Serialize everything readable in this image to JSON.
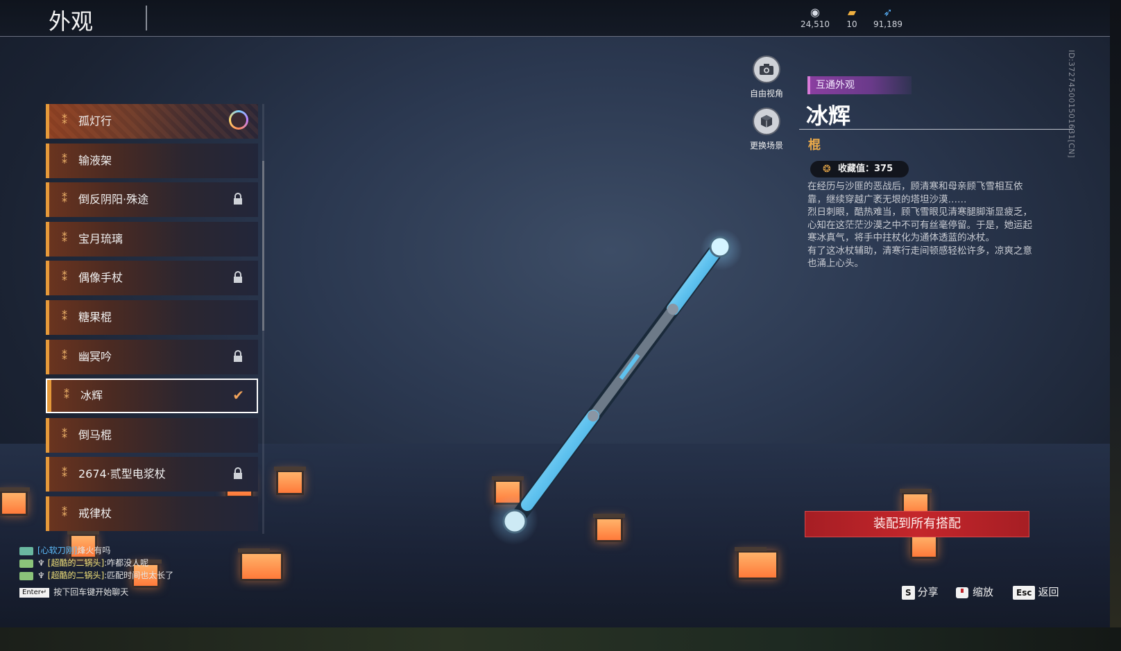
{
  "header": {
    "title": "外观",
    "currencies": [
      {
        "icon": "coin-stack-icon",
        "value": "24,510"
      },
      {
        "icon": "ticket-icon",
        "value": "10"
      },
      {
        "icon": "feather-icon",
        "value": "91,189"
      }
    ]
  },
  "list": {
    "items": [
      {
        "label": "孤灯行",
        "state": "featured"
      },
      {
        "label": "输液架",
        "state": "normal"
      },
      {
        "label": "倒反阴阳·殊途",
        "state": "locked"
      },
      {
        "label": "宝月琉璃",
        "state": "normal"
      },
      {
        "label": "偶像手杖",
        "state": "locked"
      },
      {
        "label": "糖果棍",
        "state": "normal"
      },
      {
        "label": "幽冥吟",
        "state": "locked"
      },
      {
        "label": "冰辉",
        "state": "selected"
      },
      {
        "label": "倒马棍",
        "state": "normal"
      },
      {
        "label": "2674·贰型电浆杖",
        "state": "locked"
      },
      {
        "label": "戒律杖",
        "state": "normal"
      }
    ]
  },
  "view_buttons": {
    "free_view": "自由视角",
    "change_scene": "更换场景"
  },
  "detail": {
    "tag": "互通外观",
    "name": "冰辉",
    "type": "棍",
    "collect_label": "收藏值：375",
    "description": [
      "在经历与沙匪的恶战后，顾清寒和母亲顾飞雪相互依靠，继续穿越广袤无垠的塔坦沙漠……",
      "烈日刺眼，酷热难当，顾飞雪眼见清寒腿脚渐显疲乏，心知在这茫茫沙漠之中不可有丝毫停留。于是，她运起寒冰真气，将手中拄杖化为通体透蓝的冰杖。",
      "有了这冰杖辅助，清寒行走间顿感轻松许多，凉爽之意也涌上心头。"
    ],
    "id_text": "ID:372745001501631[CN]",
    "equip_button": "装配到所有搭配"
  },
  "hints": {
    "share_key": "S",
    "share_label": "分享",
    "zoom_label": "缩放",
    "back_key": "Esc",
    "back_label": "返回"
  },
  "chat": {
    "lines": [
      {
        "name": "[心软刀刚]",
        "message": "烽火有吗"
      },
      {
        "name": "[超酷的二锅头]",
        "message": ":咋都没人呢"
      },
      {
        "name": "[超酷的二锅头]",
        "message": ":匹配时间也太长了"
      }
    ],
    "enter_key": "Enter↵",
    "prompt": "按下回车键开始聊天"
  },
  "colors": {
    "accent_orange": "#e69a3a",
    "equip_red": "#c4262b",
    "tag_purple": "#8a3fa0",
    "type_gold": "#e8a84a"
  }
}
